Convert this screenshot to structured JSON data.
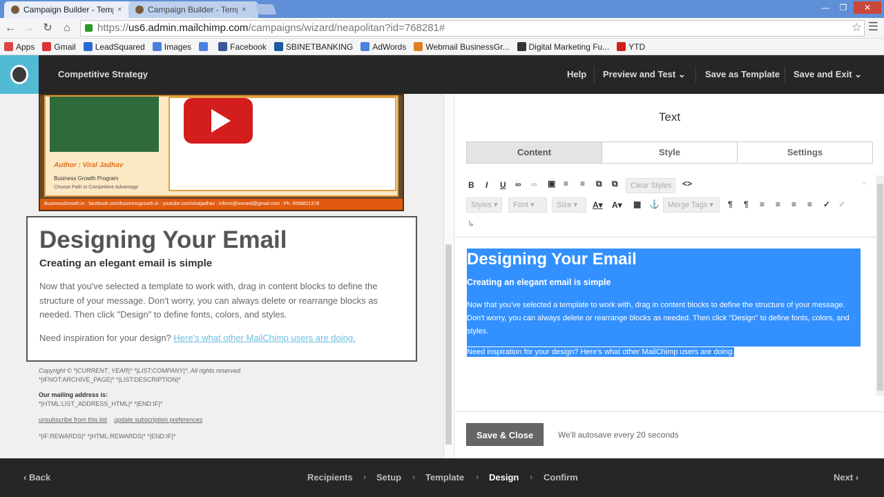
{
  "browser": {
    "tabs": [
      {
        "title": "Campaign Builder - Temp",
        "close": "×"
      },
      {
        "title": "Campaign Builder - Temp",
        "close": "×"
      }
    ],
    "window_buttons": [
      "—",
      "❐",
      "✕"
    ],
    "url_prefix": "https://",
    "url_host": "us6.admin.mailchimp.com",
    "url_path": "/campaigns/wizard/neapolitan?id=768281#",
    "bookmarks": [
      {
        "label": "Apps",
        "color": "#d44"
      },
      {
        "label": "Gmail",
        "color": "#d33"
      },
      {
        "label": "LeadSquared",
        "color": "#2a6ad0"
      },
      {
        "label": "Images",
        "color": "#4a80e0"
      },
      {
        "label": "",
        "color": "#4a80e0"
      },
      {
        "label": "Facebook",
        "color": "#3b5998"
      },
      {
        "label": "SBINETBANKING",
        "color": "#1a5aa0"
      },
      {
        "label": "AdWords",
        "color": "#4a80e0"
      },
      {
        "label": "Webmail BusinessGr...",
        "color": "#e08020"
      },
      {
        "label": "Digital Marketing Fu...",
        "color": "#333"
      },
      {
        "label": "YTD",
        "color": "#d41e1e"
      }
    ]
  },
  "header": {
    "campaign_name": "Competitive Strategy",
    "help": "Help",
    "preview": "Preview and Test",
    "save_template": "Save as Template",
    "save_exit": "Save and Exit"
  },
  "preview": {
    "banner": {
      "author": "Author : Viral Jadhav",
      "program": "Business Growth Program",
      "tagline": "Choose Path to Competitive Advantage",
      "footer": "BusinessGrowth.in : facebook.com/businessgrowth.in : youtube.com/viraljadhav : inform@someid@gmail.com : Ph. 9558821378"
    },
    "heading": "Designing Your Email",
    "subheading": "Creating an elegant email is simple",
    "paragraph": "Now that you've selected a template to work with, drag in content blocks to define the structure of your message. Don't worry, you can always delete or rearrange blocks as needed. Then click \"Design\" to define fonts, colors, and styles.",
    "need": "Need inspiration for your design?",
    "need_link": "Here's what other MailChimp users are doing.",
    "footer": {
      "copyright": "Copyright © *|CURRENT_YEAR|* *|LIST:COMPANY|*, All rights reserved.",
      "archive": "*|IFNOT:ARCHIVE_PAGE|* *|LIST:DESCRIPTION|*",
      "mailing_label": "Our mailing address is:",
      "address": "*|HTML:LIST_ADDRESS_HTML|* *|END:IF|*",
      "unsubscribe": "unsubscribe from this list",
      "update": "update subscription preferences",
      "rewards": "*|IF:REWARDS|* *|HTML:REWARDS|* *|END:IF|*"
    }
  },
  "editor": {
    "title": "Text",
    "tabs": [
      "Content",
      "Style",
      "Settings"
    ],
    "toolbar": {
      "clear_styles": "Clear Styles",
      "styles": "Styles",
      "font": "Font",
      "size": "Size",
      "merge_tags": "Merge Tags"
    },
    "content": {
      "heading": "Designing Your Email",
      "subheading": "Creating an elegant email is simple",
      "paragraph": "Now that you've selected a template to work with, drag in content blocks to define the structure of your message. Don't worry, you can always delete or rearrange blocks as needed. Then click \"Design\" to define fonts, colors, and styles.",
      "need": "Need inspiration for your design? Here's what other MailChimp users are doing."
    },
    "save_close": "Save & Close",
    "autosave": "We'll autosave every 20 seconds"
  },
  "wizard": {
    "back": "Back",
    "steps": [
      "Recipients",
      "Setup",
      "Template",
      "Design",
      "Confirm"
    ],
    "current": "Design",
    "next": "Next"
  },
  "colors": {
    "header_bg": "#262626",
    "logo_bg": "#52bad5",
    "selection": "#3390ff"
  }
}
